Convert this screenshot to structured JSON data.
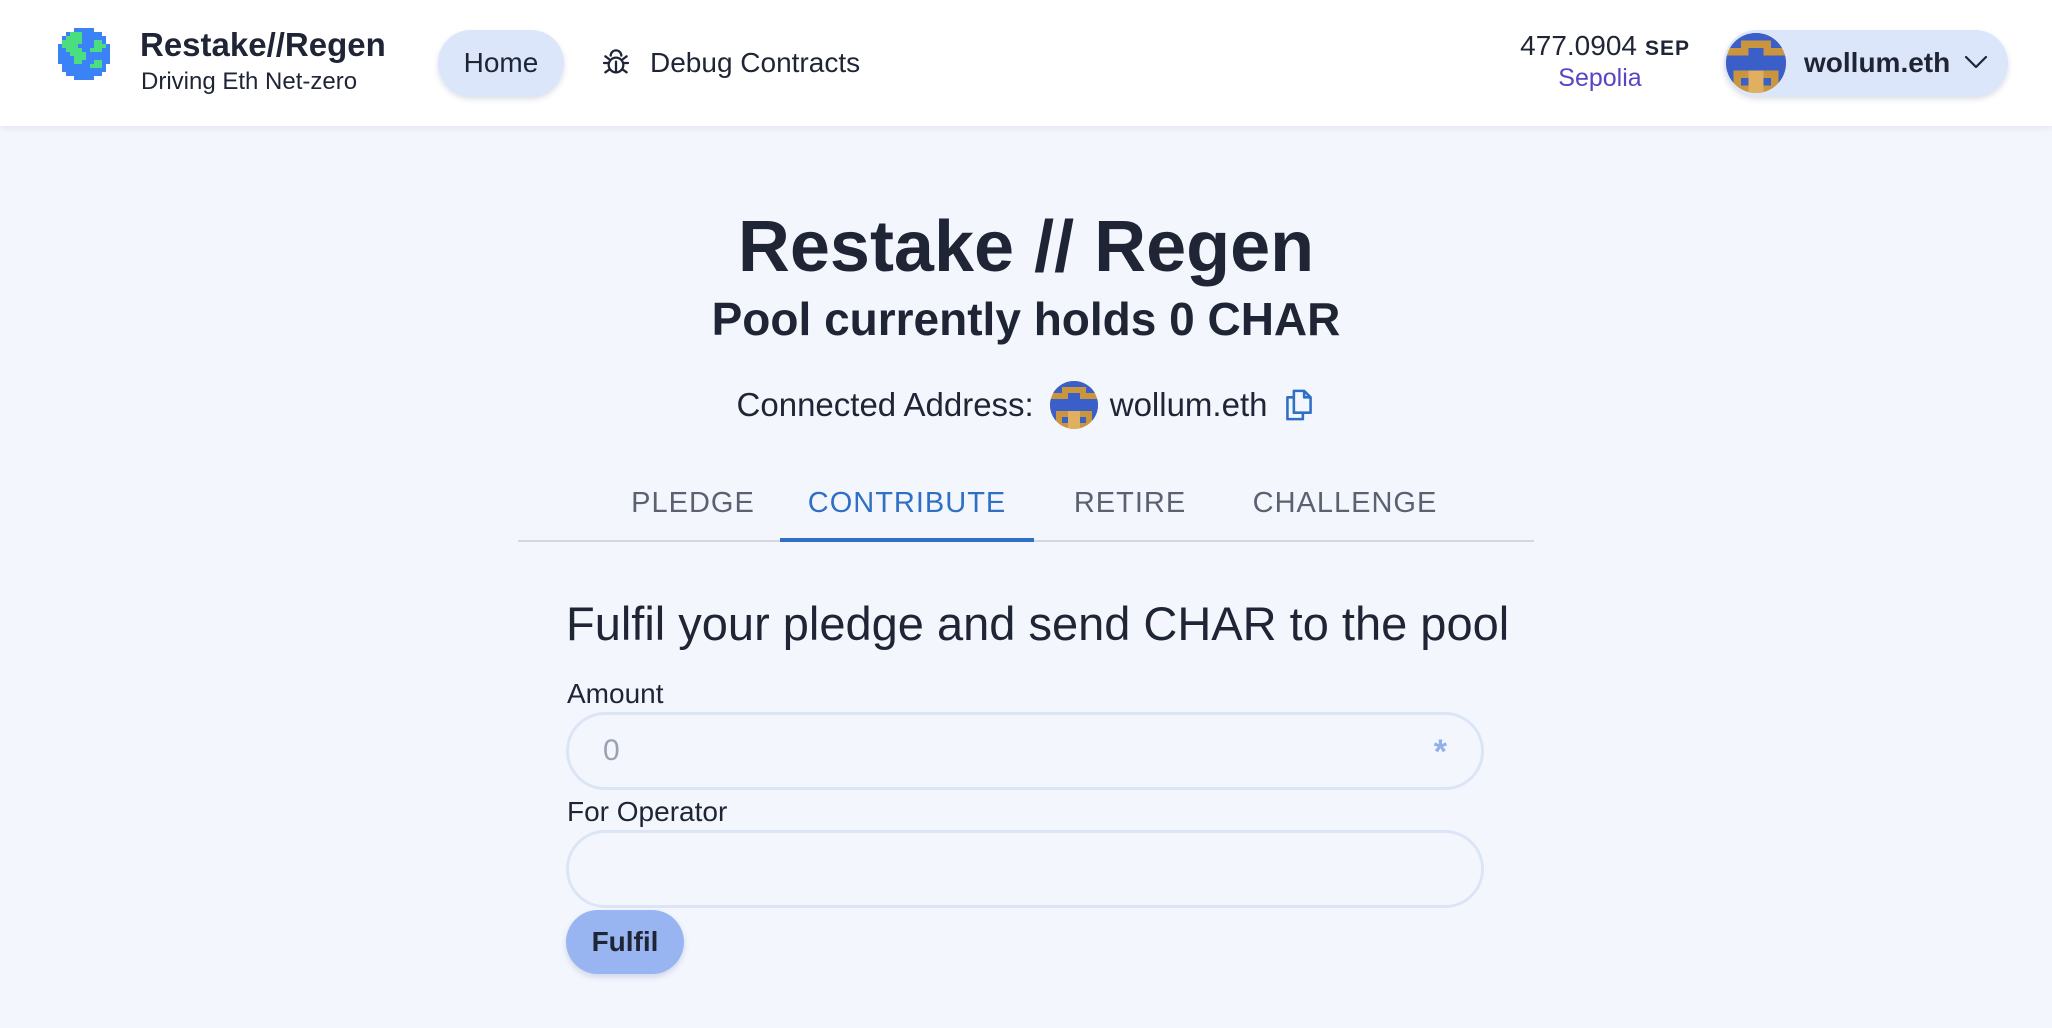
{
  "header": {
    "brand_title": "Restake//Regen",
    "brand_subtitle": "Driving Eth Net-zero",
    "logo_icon": "globe-icon",
    "nav": {
      "home_label": "Home",
      "debug_label": "Debug Contracts",
      "debug_icon": "bug-icon"
    },
    "balance": {
      "value": "477.0904",
      "unit": "SEP",
      "network": "Sepolia"
    },
    "account": {
      "name": "wollum.eth",
      "icon": "chevron-down-icon"
    }
  },
  "main": {
    "title": "Restake // Regen",
    "pool_status": "Pool currently holds 0 CHAR",
    "connected_label": "Connected Address:",
    "connected_name": "wollum.eth",
    "copy_icon": "copy-icon"
  },
  "tabs": [
    {
      "label": "PLEDGE",
      "active": false
    },
    {
      "label": "CONTRIBUTE",
      "active": true
    },
    {
      "label": "RETIRE",
      "active": false
    },
    {
      "label": "CHALLENGE",
      "active": false
    }
  ],
  "form": {
    "heading": "Fulfil your pledge and send CHAR to the pool",
    "amount_label": "Amount",
    "amount_placeholder": "0",
    "amount_value": "",
    "amount_suffix": "*",
    "operator_label": "For Operator",
    "operator_placeholder": "",
    "operator_value": "",
    "submit_label": "Fulfil"
  },
  "colors": {
    "accent": "#2f6fc4",
    "pill_bg": "#dbe6fb",
    "submit_bg": "#98b5f2",
    "network": "#5a43c4",
    "page_bg": "#f3f6fd"
  }
}
